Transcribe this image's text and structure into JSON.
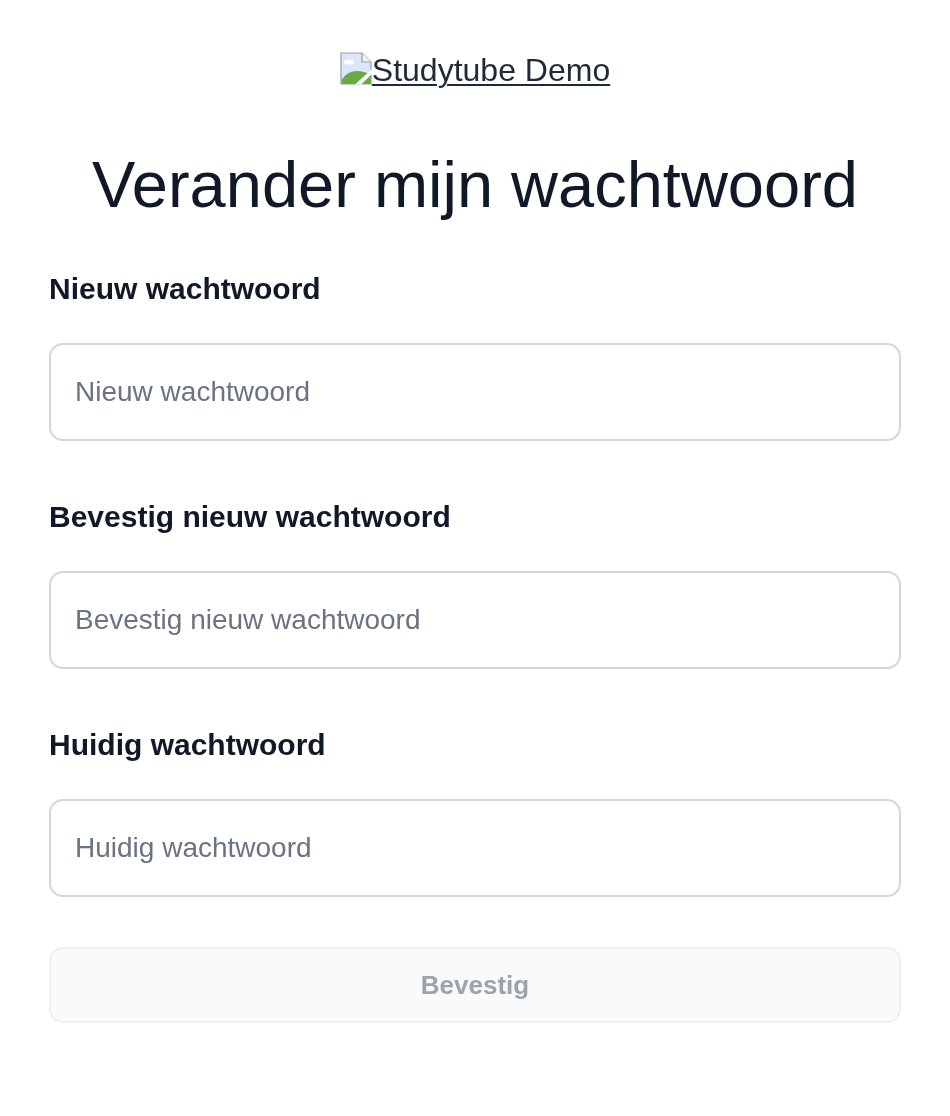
{
  "logo": {
    "alt_text": "Studytube Demo"
  },
  "title": "Verander mijn wachtwoord",
  "fields": [
    {
      "label": "Nieuw wachtwoord",
      "placeholder": "Nieuw wachtwoord"
    },
    {
      "label": "Bevestig nieuw wachtwoord",
      "placeholder": "Bevestig nieuw wachtwoord"
    },
    {
      "label": "Huidig wachtwoord",
      "placeholder": "Huidig wachtwoord"
    }
  ],
  "submit_button": {
    "label": "Bevestig",
    "disabled": true
  }
}
